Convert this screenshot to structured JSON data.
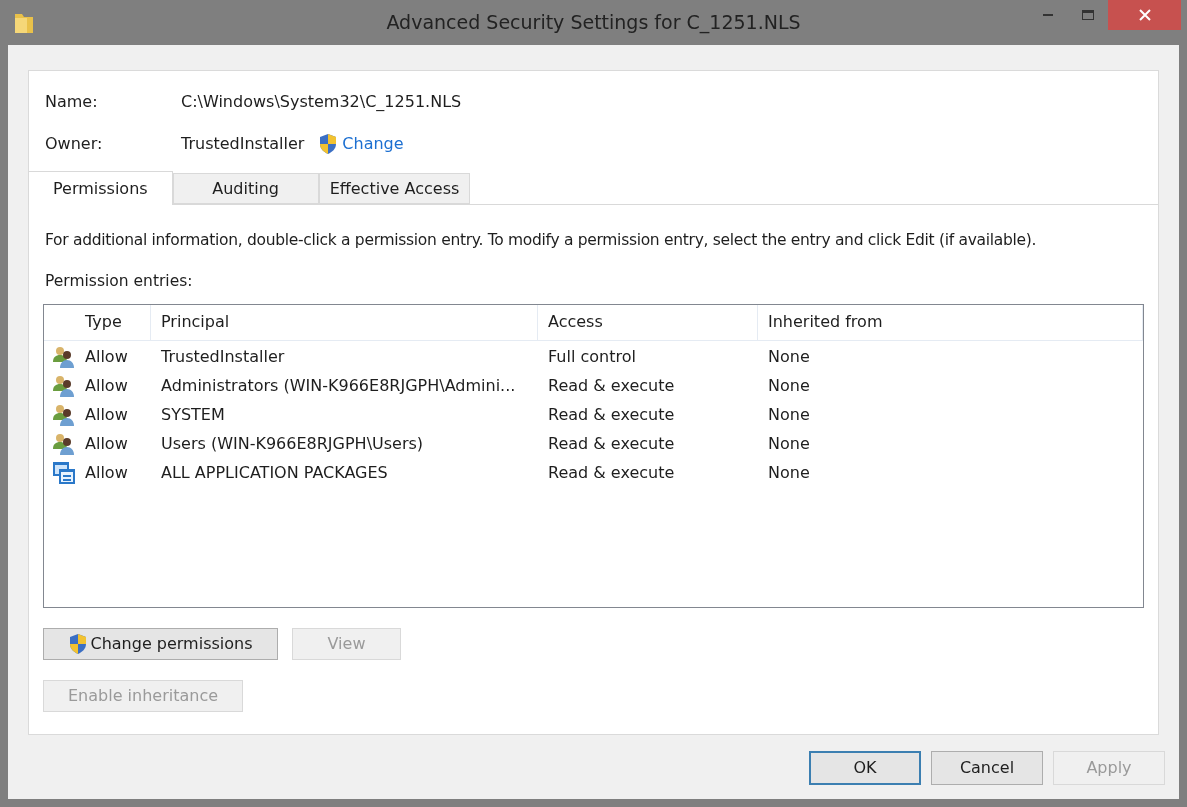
{
  "window": {
    "title": "Advanced Security Settings for C_1251.NLS"
  },
  "name": {
    "label": "Name:",
    "value": "C:\\Windows\\System32\\C_1251.NLS"
  },
  "owner": {
    "label": "Owner:",
    "value": "TrustedInstaller",
    "link": "Change"
  },
  "tabs": [
    {
      "label": "Permissions",
      "selected": true
    },
    {
      "label": "Auditing",
      "selected": false
    },
    {
      "label": "Effective Access",
      "selected": false
    }
  ],
  "info": "For additional information, double-click a permission entry. To modify a permission entry, select the entry and click Edit (if available).",
  "entries_label": "Permission entries:",
  "table": {
    "columns": [
      "Type",
      "Principal",
      "Access",
      "Inherited from"
    ],
    "rows": [
      {
        "kind": "group",
        "type": "Allow",
        "principal": "TrustedInstaller",
        "access": "Full control",
        "inherited": "None"
      },
      {
        "kind": "group",
        "type": "Allow",
        "principal": "Administrators (WIN-K966E8RJGPH\\Admini...",
        "access": "Read & execute",
        "inherited": "None"
      },
      {
        "kind": "group",
        "type": "Allow",
        "principal": "SYSTEM",
        "access": "Read & execute",
        "inherited": "None"
      },
      {
        "kind": "group",
        "type": "Allow",
        "principal": "Users (WIN-K966E8RJGPH\\Users)",
        "access": "Read & execute",
        "inherited": "None"
      },
      {
        "kind": "package",
        "type": "Allow",
        "principal": "ALL APPLICATION PACKAGES",
        "access": "Read & execute",
        "inherited": "None"
      }
    ]
  },
  "actions": [
    {
      "label": "Change permissions",
      "shield": true,
      "disabled": false
    },
    {
      "label": "View",
      "shield": false,
      "disabled": true
    }
  ],
  "inheritance_button": {
    "label": "Enable inheritance",
    "disabled": true
  },
  "footer_buttons": [
    {
      "label": "OK",
      "default": true,
      "disabled": false
    },
    {
      "label": "Cancel",
      "default": false,
      "disabled": false
    },
    {
      "label": "Apply",
      "default": false,
      "disabled": true
    }
  ]
}
